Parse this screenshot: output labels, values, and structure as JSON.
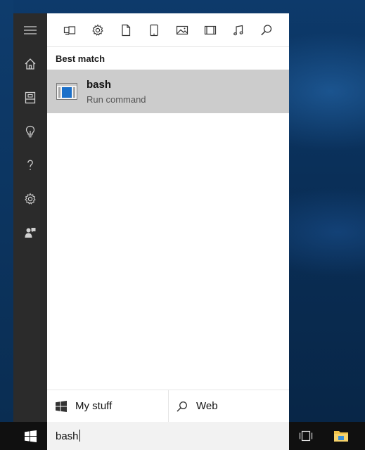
{
  "rail": {
    "items": [
      {
        "icon": "hamburger-menu-icon"
      },
      {
        "icon": "home-icon"
      },
      {
        "icon": "notebook-icon"
      },
      {
        "icon": "lightbulb-icon"
      },
      {
        "icon": "help-icon"
      },
      {
        "icon": "settings-icon"
      },
      {
        "icon": "feedback-icon"
      }
    ]
  },
  "filters": {
    "icons": [
      "apps-icon",
      "settings-icon",
      "documents-icon",
      "tablet-icon",
      "photos-icon",
      "videos-icon",
      "music-icon",
      "search-icon"
    ]
  },
  "results": {
    "heading": "Best match",
    "best_match": {
      "title": "bash",
      "subtitle": "Run command",
      "icon": "terminal-window-icon"
    }
  },
  "scopes": {
    "my_stuff": "My stuff",
    "web": "Web"
  },
  "taskbar": {
    "search_value": "bash"
  },
  "colors": {
    "rail_bg": "#2b2b2b",
    "selected_row_bg": "#cccccc",
    "taskbar_bg": "#101010",
    "searchbox_bg": "#f2f2f2",
    "app_icon_blue": "#1a6fc9"
  }
}
